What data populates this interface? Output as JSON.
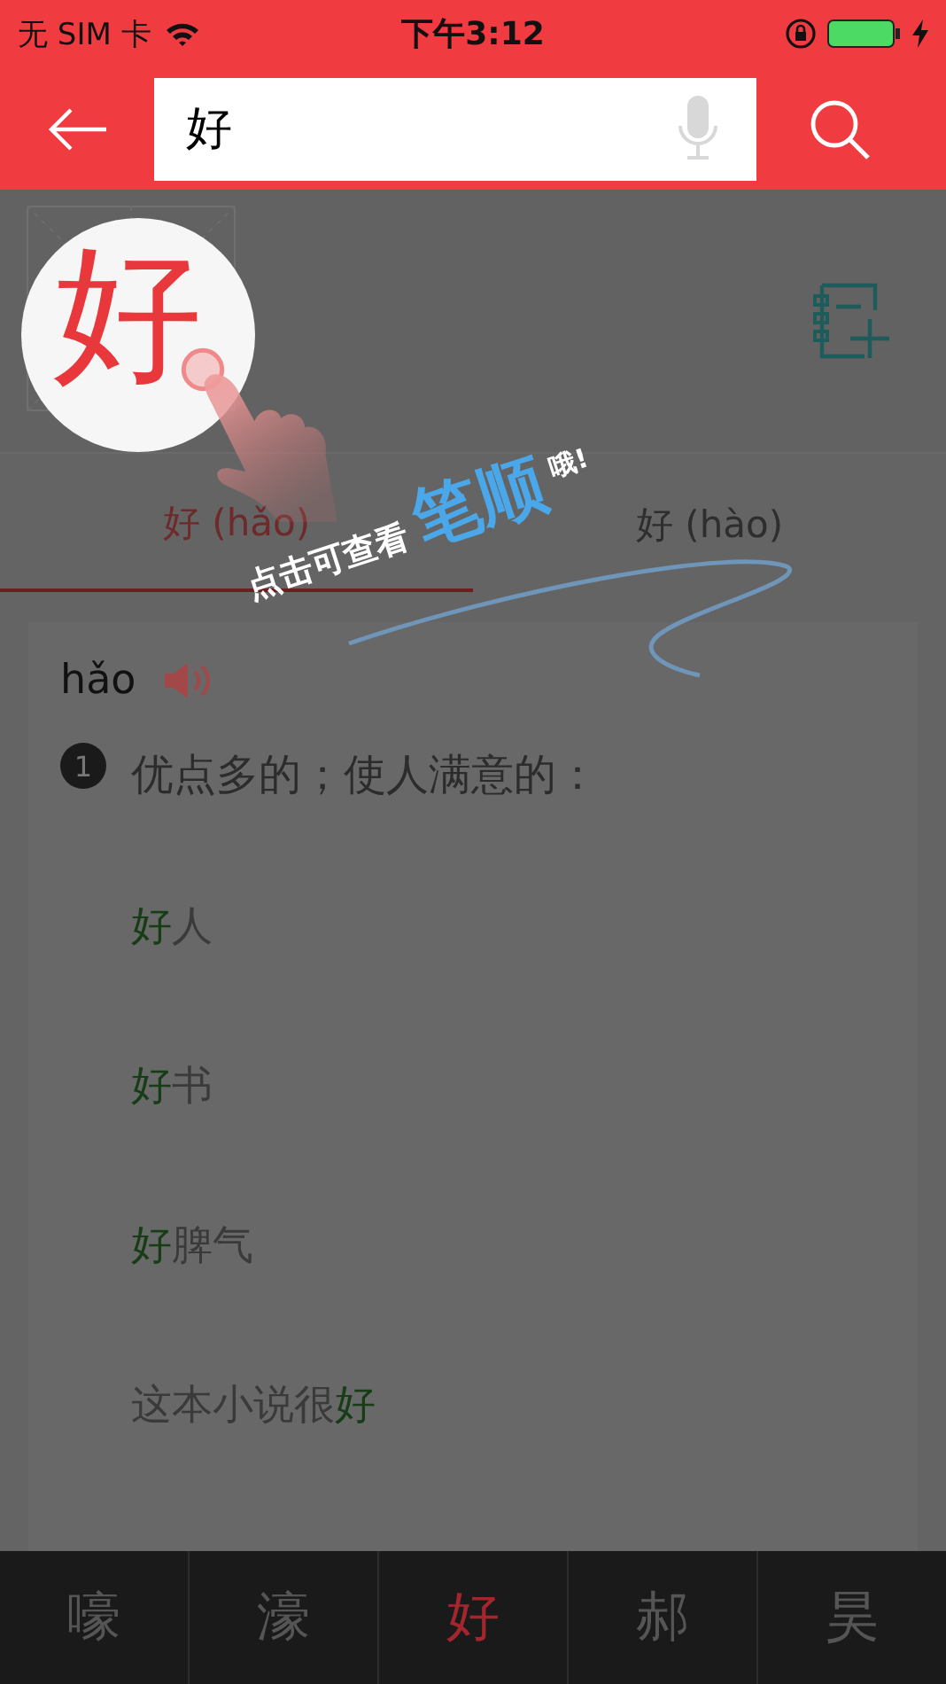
{
  "status_bar": {
    "carrier": "无 SIM 卡",
    "time": "下午3:12"
  },
  "search": {
    "value": "好"
  },
  "character": {
    "glyph": "好"
  },
  "readings": [
    {
      "label": "好 (hǎo)",
      "selected": true
    },
    {
      "label": "好 (hào)",
      "selected": false
    }
  ],
  "entry": {
    "pinyin": "hǎo",
    "definitions": [
      {
        "number": "1",
        "text": "优点多的；使人满意的：",
        "examples": [
          [
            {
              "text": "好",
              "highlight": true
            },
            {
              "text": "人",
              "highlight": false
            }
          ],
          [
            {
              "text": "好",
              "highlight": true
            },
            {
              "text": "书",
              "highlight": false
            }
          ],
          [
            {
              "text": "好",
              "highlight": true
            },
            {
              "text": "脾气",
              "highlight": false
            }
          ],
          [
            {
              "text": "这本小说很",
              "highlight": false
            },
            {
              "text": "好",
              "highlight": true
            }
          ]
        ]
      }
    ]
  },
  "bottom_tabs": [
    {
      "label": "嚎",
      "selected": false
    },
    {
      "label": "濠",
      "selected": false
    },
    {
      "label": "好",
      "selected": true
    },
    {
      "label": "郝",
      "selected": false
    },
    {
      "label": "昊",
      "selected": false
    }
  ],
  "tip": {
    "parts": [
      {
        "text": "点击可查看",
        "kind": "plain"
      },
      {
        "text": "笔顺",
        "kind": "accent"
      },
      {
        "text": "哦!",
        "kind": "small"
      }
    ]
  }
}
